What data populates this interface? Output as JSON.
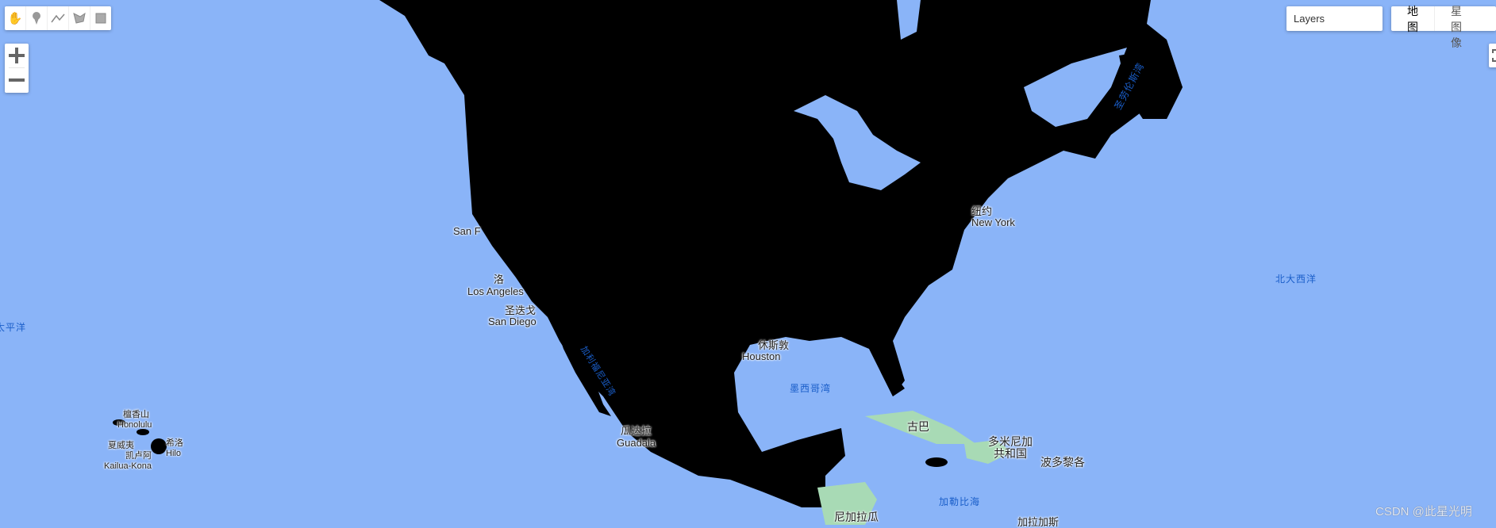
{
  "toolbar": {
    "tools": [
      {
        "name": "hand-icon",
        "title": "pan"
      },
      {
        "name": "marker-icon",
        "title": "point"
      },
      {
        "name": "line-icon",
        "title": "line"
      },
      {
        "name": "polygon-icon",
        "title": "polygon"
      },
      {
        "name": "rectangle-icon",
        "title": "rectangle"
      }
    ]
  },
  "zoom": {
    "in": "+",
    "out": "−"
  },
  "layers": {
    "label": "Layers"
  },
  "map_type": {
    "map": "地图",
    "satellite": "卫星图像"
  },
  "labels": {
    "san_francisco": "San F",
    "los_angeles_cn": "洛",
    "los_angeles": "Los Angeles",
    "san_diego_cn": "圣迭戈",
    "san_diego": "San Diego",
    "honolulu_cn": "檀香山",
    "honolulu": "Honolulu",
    "hawaii_cn": "夏威夷",
    "kailua_cn": "凯卢阿",
    "kailua": "Kailua-Kona",
    "hilo_cn": "希洛",
    "hilo": "Hilo",
    "guadalajara_cn": "瓜达拉",
    "guadalajara": "Guadala",
    "houston_cn": "休斯敦",
    "houston": "Houston",
    "new_york_cn": "纽约",
    "new_york": "New York",
    "cuba": "古巴",
    "dominican_1": "多米尼加",
    "dominican_2": "共和国",
    "puerto_rico": "波多黎各",
    "nicaragua": "尼加拉瓜",
    "caracas": "加拉加斯"
  },
  "water": {
    "pacific": "太平洋",
    "atlantic": "北大西洋",
    "gulf_mexico": "墨西哥湾",
    "caribbean": "加勒比海",
    "st_lawrence": "圣劳伦斯湾",
    "gulf_california": "加利福尼亚湾"
  },
  "watermark": "CSDN @此星光明",
  "colors": {
    "water": "#8ab4f8",
    "land": "#000000",
    "vegetation": "#a8dab5"
  }
}
